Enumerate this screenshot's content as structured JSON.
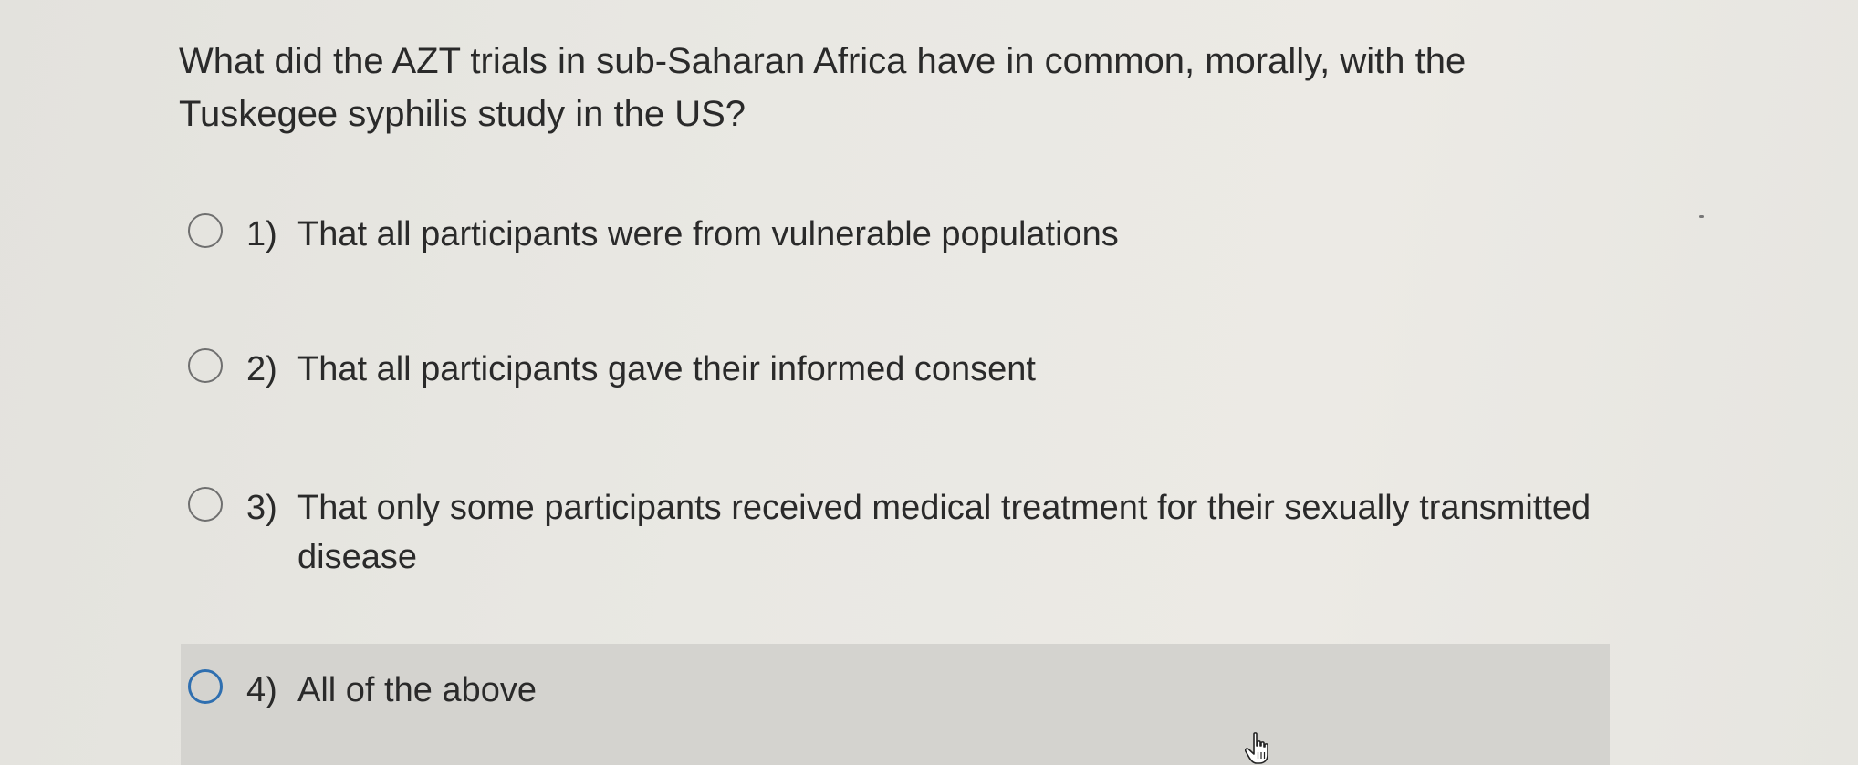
{
  "question": {
    "text": "What did the AZT trials in sub-Saharan Africa have in common, morally, with the Tuskegee syphilis study in the US?"
  },
  "options": [
    {
      "number": "1)",
      "text": "That all participants were from vulnerable populations"
    },
    {
      "number": "2)",
      "text": "That all participants gave their informed consent"
    },
    {
      "number": "3)",
      "text": "That only some participants received medical treatment for their sexually transmitted disease"
    },
    {
      "number": "4)",
      "text": "All of the above"
    }
  ],
  "state": {
    "hovered_option": "4)"
  },
  "colors": {
    "hover_background": "#d4d3cf",
    "radio_border": "#6f6f6f",
    "radio_focus_border": "#2f6fb0"
  },
  "icons": {
    "cursor": "hand-pointer-icon"
  }
}
